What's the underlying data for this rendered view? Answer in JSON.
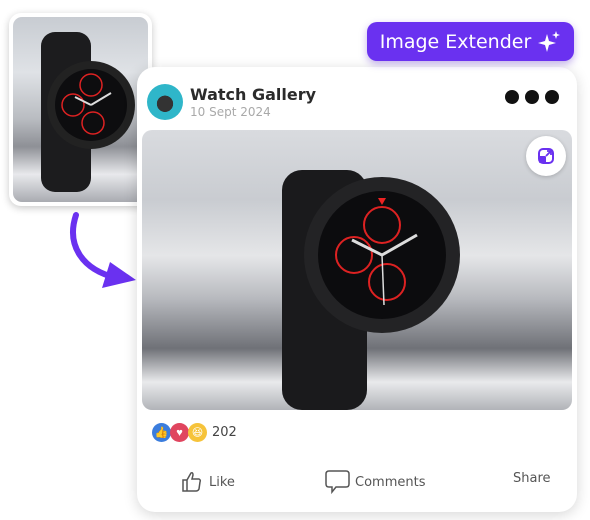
{
  "badge": {
    "label": "Image Extender",
    "icon": "sparkle-icon",
    "color": "#6a31f0"
  },
  "thumbnail": {
    "alt": "Original watch photo",
    "icon": "watch-image"
  },
  "post": {
    "author": "Watch Gallery",
    "date": "10 Sept 2024",
    "menu_icon": "more-dots-icon",
    "photo_alt": "Extended watch photo",
    "extend_icon": "expand-image-icon",
    "reactions": {
      "icons": [
        "like-icon",
        "heart-icon",
        "laugh-icon"
      ],
      "count": "202"
    },
    "actions": [
      {
        "label": "Like",
        "icon": "thumbs-up-icon"
      },
      {
        "label": "Comments",
        "icon": "comment-icon"
      },
      {
        "label": "Share",
        "icon": ""
      }
    ]
  }
}
